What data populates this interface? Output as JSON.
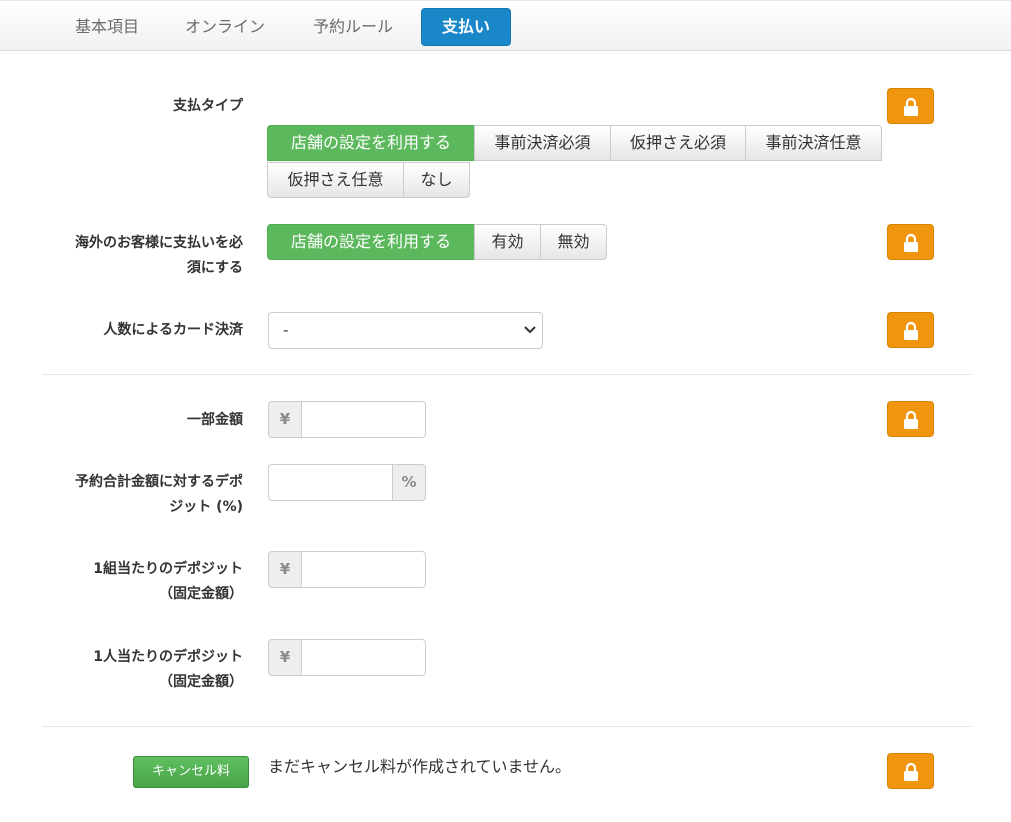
{
  "tabs": [
    {
      "label": "基本項目",
      "active": false
    },
    {
      "label": "オンライン",
      "active": false
    },
    {
      "label": "予約ルール",
      "active": false
    },
    {
      "label": "支払い",
      "active": true
    }
  ],
  "payment_type": {
    "label": "支払タイプ",
    "options": [
      "店舗の設定を利用する",
      "事前決済必須",
      "仮押さえ必須",
      "事前決済任意",
      "仮押さえ任意",
      "なし"
    ],
    "selected": "店舗の設定を利用する"
  },
  "overseas": {
    "label_line1": "海外のお客様に支払いを必",
    "label_line2": "須にする",
    "options": [
      "店舗の設定を利用する",
      "有効",
      "無効"
    ],
    "selected": "店舗の設定を利用する"
  },
  "card_by_people": {
    "label": "人数によるカード決済",
    "value": "-"
  },
  "partial_amount": {
    "label": "一部金額",
    "prefix": "¥",
    "value": ""
  },
  "deposit_percent": {
    "label_line1": "予約合計金額に対するデポ",
    "label_line2": "ジット (%)",
    "suffix": "%",
    "value": ""
  },
  "deposit_per_group": {
    "label_line1": "1組当たりのデポジット",
    "label_line2": "（固定金額）",
    "prefix": "¥",
    "value": ""
  },
  "deposit_per_person": {
    "label_line1": "1人当たりのデポジット",
    "label_line2": "（固定金額）",
    "prefix": "¥",
    "value": ""
  },
  "cancel_fee": {
    "button_label": "キャンセル料",
    "message": "まだキャンセル料が作成されていません。"
  },
  "icons": {
    "lock": "lock-icon",
    "dropdown": "chevron-down-icon"
  },
  "colors": {
    "tab_active": "#1a87c9",
    "selected_option": "#5cb85c",
    "lock_button": "#f0960e"
  }
}
